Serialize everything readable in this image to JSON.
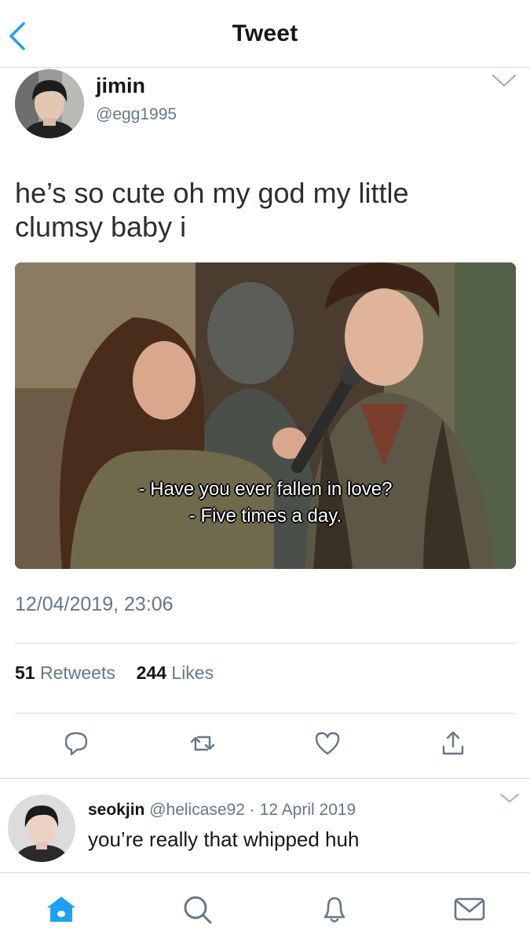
{
  "header": {
    "title": "Tweet"
  },
  "tweet": {
    "display_name": "jimin",
    "handle": "@egg1995",
    "text": "he’s so cute oh my god my little clumsy baby i",
    "media": {
      "subtitle_line1": "- Have you ever fallen in love?",
      "subtitle_line2": "- Five times a day."
    },
    "timestamp": "12/04/2019, 23:06",
    "stats": {
      "retweets_count": "51",
      "retweets_label": "Retweets",
      "likes_count": "244",
      "likes_label": "Likes"
    },
    "actions": [
      "reply-icon",
      "retweet-icon",
      "like-icon",
      "share-icon"
    ]
  },
  "reply": {
    "display_name": "seokjin",
    "handle": "@helicase92",
    "separator": "·",
    "date": "12 April 2019",
    "text": "you’re really that whipped huh"
  },
  "tabbar": [
    "home-icon",
    "search-icon",
    "notifications-icon",
    "messages-icon"
  ],
  "colors": {
    "accent": "#1da1f2",
    "secondary_text": "#657786",
    "divider": "#d9dde1"
  }
}
